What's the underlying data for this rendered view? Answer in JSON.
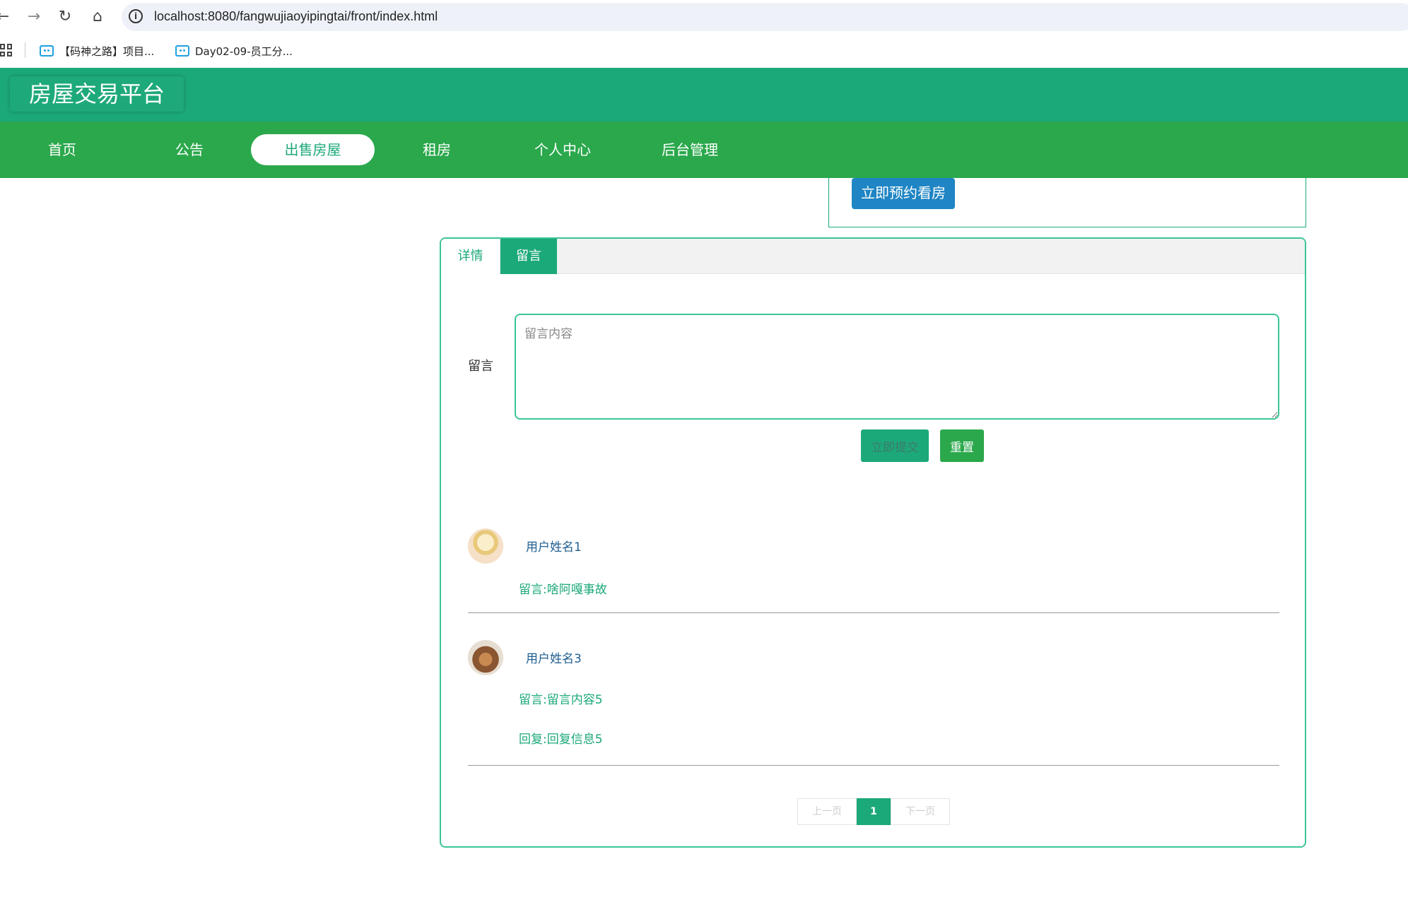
{
  "browser": {
    "url": "localhost:8080/fangwujiaoyipingtai/front/index.html",
    "bookmarks": [
      {
        "label": "【码神之路】项目..."
      },
      {
        "label": "Day02-09-员工分..."
      }
    ]
  },
  "site": {
    "title": "房屋交易平台"
  },
  "nav": {
    "items": [
      {
        "label": "首页"
      },
      {
        "label": "公告"
      },
      {
        "label": "出售房屋"
      },
      {
        "label": "租房"
      },
      {
        "label": "个人中心"
      },
      {
        "label": "后台管理"
      }
    ],
    "active_index": 2
  },
  "detail": {
    "book_button": "立即预约看房"
  },
  "tabs": [
    {
      "label": "详情"
    },
    {
      "label": "留言"
    }
  ],
  "comment_form": {
    "label": "留言",
    "placeholder": "留言内容",
    "submit_label": "立即提交",
    "reset_label": "重置"
  },
  "comments": [
    {
      "user": "用户姓名1",
      "message": "留言:啥阿嘎事故",
      "reply": ""
    },
    {
      "user": "用户姓名3",
      "message": "留言:留言内容5",
      "reply": "回复:回复信息5"
    }
  ],
  "pagination": {
    "prev": "上一页",
    "current": "1",
    "next": "下一页"
  },
  "colors": {
    "header": "#1ca97a",
    "nav": "#2ba84c",
    "book_button": "#1f85c4"
  }
}
